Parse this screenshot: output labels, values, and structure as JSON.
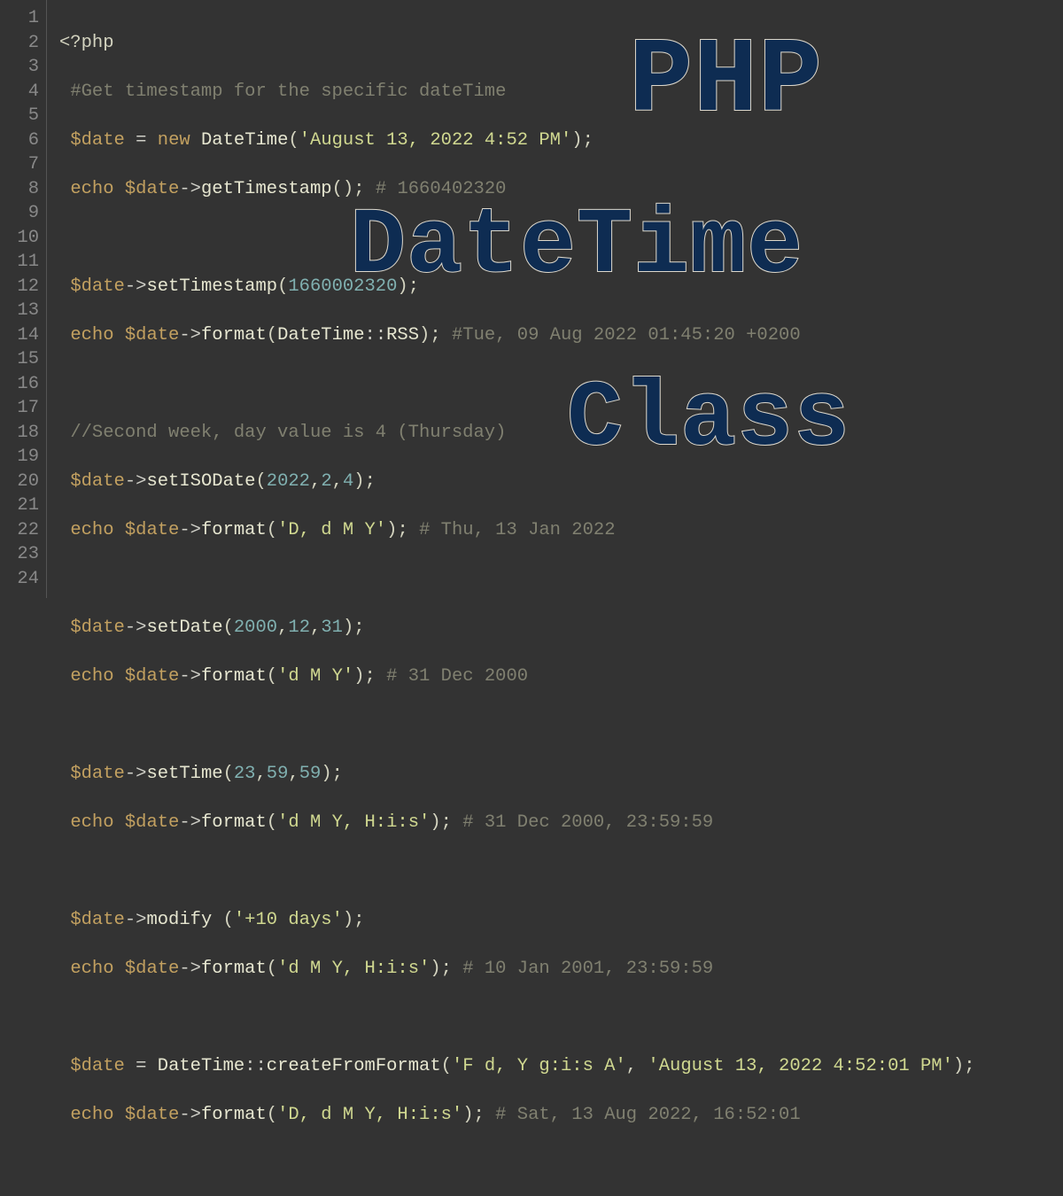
{
  "overlay": {
    "line1": "PHP",
    "line2": "DateTime",
    "line3": "Class"
  },
  "lineNumbers": [
    "1",
    "2",
    "3",
    "4",
    "5",
    "6",
    "7",
    "8",
    "9",
    "10",
    "11",
    "12",
    "13",
    "14",
    "15",
    "16",
    "17",
    "18",
    "19",
    "20",
    "21",
    "22",
    "23",
    "24"
  ],
  "tokens": {
    "phpOpen": "<?php",
    "cmt1": "#Get timestamp for the specific dateTime",
    "varDate": "$date",
    "eq": "=",
    "kwNew": "new",
    "clsDateTime": "DateTime",
    "lp": "(",
    "rp": ")",
    "semi": ";",
    "strAug13": "'August 13, 2022 4:52 PM'",
    "kwEcho": "echo",
    "arrow": "->",
    "fnGetTs": "getTimestamp",
    "cmtTs": "# 1660402320",
    "fnSetTs": "setTimestamp",
    "numTs": "1660002320",
    "fnFormat": "format",
    "dColon": "::",
    "constRSS": "RSS",
    "cmtRss": "#Tue, 09 Aug 2022 01:45:20 +0200",
    "cmtSecond": "//Second week, day value is 4 (Thursday)",
    "fnSetISO": "setISODate",
    "n2022": "2022",
    "n2": "2",
    "n4": "4",
    "comma": ",",
    "strDdMY": "'D, d M Y'",
    "cmtIso": "# Thu, 13 Jan 2022",
    "fnSetDate": "setDate",
    "n2000": "2000",
    "n12": "12",
    "n31": "31",
    "strdMY": "'d M Y'",
    "cmtDec": "# 31 Dec 2000",
    "fnSetTime": "setTime",
    "n23": "23",
    "n59": "59",
    "strdMYHis": "'d M Y, H:i:s'",
    "cmtTime": "# 31 Dec 2000, 23:59:59",
    "fnModify": "modify",
    "sp": " ",
    "str10days": "'+10 days'",
    "cmtMod": "# 10 Jan 2001, 23:59:59",
    "fnCFF": "createFromFormat",
    "strFmt1": "'F d, Y g:i:s A'",
    "strFull": "'August 13, 2022 4:52:01 PM'",
    "strDdMYHis": "'D, d M Y, H:i:s'",
    "cmtFinal": "# Sat, 13 Aug 2022, 16:52:01"
  }
}
